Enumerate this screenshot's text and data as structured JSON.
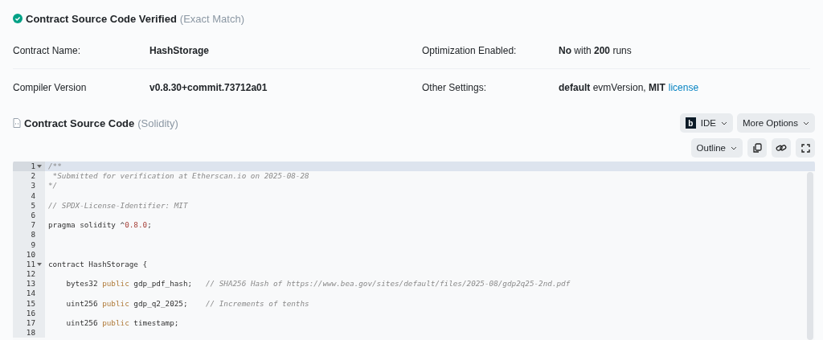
{
  "verification": {
    "title": "Contract Source Code Verified",
    "note": "(Exact Match)"
  },
  "details": [
    {
      "label": "Contract Name:",
      "value": "HashStorage",
      "bold": true
    },
    {
      "label": "Optimization Enabled:",
      "value": "**No** with **200** runs",
      "bold": false
    },
    {
      "label": "Compiler Version",
      "value": "v0.8.30+commit.73712a01",
      "bold": true
    },
    {
      "label": "Other Settings:",
      "value": "**default** evmVersion, **MIT**",
      "bold": false,
      "link": "license"
    }
  ],
  "source": {
    "title": "Contract Source Code",
    "language": "(Solidity)"
  },
  "toolbar": {
    "ide_badge": "b",
    "ide_button": "IDE",
    "more_button": "More Options",
    "outline_button": "Outline"
  },
  "code": [
    {
      "number": "1",
      "active": true,
      "foldable": true,
      "tokens": [
        {
          "kind": "comment",
          "text": "/**"
        }
      ]
    },
    {
      "number": "2",
      "active": false,
      "foldable": false,
      "tokens": [
        {
          "kind": "comment",
          "text": " *Submitted for verification at Etherscan.io on 2025-08-28"
        }
      ]
    },
    {
      "number": "3",
      "active": false,
      "foldable": false,
      "tokens": [
        {
          "kind": "comment",
          "text": "*/"
        }
      ]
    },
    {
      "number": "4",
      "active": false,
      "foldable": false
    },
    {
      "number": "5",
      "active": false,
      "foldable": false,
      "tokens": [
        {
          "kind": "comment",
          "text": "// SPDX-License-Identifier: MIT"
        }
      ]
    },
    {
      "number": "6",
      "active": false,
      "foldable": false
    },
    {
      "number": "7",
      "active": false,
      "foldable": false,
      "tokens": [
        {
          "kind": "plain",
          "text": "pragma solidity ^"
        },
        {
          "kind": "number",
          "text": "0.8.0"
        },
        {
          "kind": "plain",
          "text": ";"
        }
      ]
    },
    {
      "number": "8",
      "active": false,
      "foldable": false
    },
    {
      "number": "9",
      "active": false,
      "foldable": false
    },
    {
      "number": "10",
      "active": false,
      "foldable": false
    },
    {
      "number": "11",
      "active": false,
      "foldable": true,
      "tokens": [
        {
          "kind": "plain",
          "text": "contract HashStorage {"
        }
      ]
    },
    {
      "number": "12",
      "active": false,
      "foldable": false
    },
    {
      "number": "13",
      "active": false,
      "foldable": false,
      "tokens": [
        {
          "kind": "plain",
          "text": "    bytes32 "
        },
        {
          "kind": "keyword",
          "text": "public"
        },
        {
          "kind": "plain",
          "text": " gdp_pdf_hash;   "
        },
        {
          "kind": "comment",
          "text": "// SHA256 Hash of https://www.bea.gov/sites/default/files/2025-08/gdp2q25-2nd.pdf"
        }
      ]
    },
    {
      "number": "14",
      "active": false,
      "foldable": false
    },
    {
      "number": "15",
      "active": false,
      "foldable": false,
      "tokens": [
        {
          "kind": "plain",
          "text": "    uint256 "
        },
        {
          "kind": "keyword",
          "text": "public"
        },
        {
          "kind": "plain",
          "text": " gdp_q2_2025;    "
        },
        {
          "kind": "comment",
          "text": "// Increments of tenths"
        }
      ]
    },
    {
      "number": "16",
      "active": false,
      "foldable": false
    },
    {
      "number": "17",
      "active": false,
      "foldable": false,
      "tokens": [
        {
          "kind": "plain",
          "text": "    uint256 "
        },
        {
          "kind": "keyword",
          "text": "public"
        },
        {
          "kind": "plain",
          "text": " timestamp;"
        }
      ]
    },
    {
      "number": "18",
      "active": false,
      "foldable": false
    }
  ]
}
